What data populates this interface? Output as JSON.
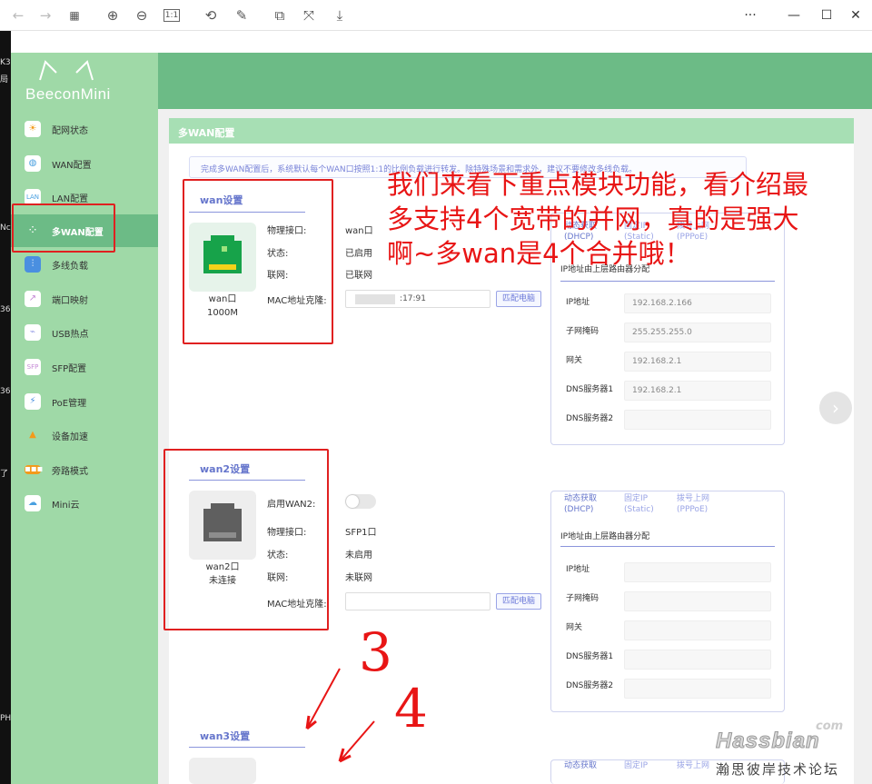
{
  "viewer": {
    "icons": [
      "back-arrow-icon",
      "forward-arrow-icon",
      "grid-icon",
      "zoom-in-icon",
      "zoom-out-icon",
      "actual-size-icon",
      "rotate-icon",
      "edit-icon",
      "crop-icon",
      "fit-icon",
      "download-icon"
    ],
    "actual_size_label": "1:1",
    "more_label": "···",
    "minimize_label": "—",
    "maximize_label": "☐",
    "close_label": "✕"
  },
  "desktop": {
    "fragments": [
      "K3",
      "局",
      "Nc",
      "36",
      "36",
      "了",
      "PH"
    ]
  },
  "app": {
    "logo": "BeeconMini",
    "nav": [
      {
        "label": "配网状态",
        "icon": "sun-icon"
      },
      {
        "label": "WAN配置",
        "icon": "globe-icon"
      },
      {
        "label": "LAN配置",
        "icon": "lan-icon"
      },
      {
        "label": "多WAN配置",
        "icon": "multi-wan-icon",
        "active": true
      },
      {
        "label": "多线负载",
        "icon": "sliders-icon"
      },
      {
        "label": "端口映射",
        "icon": "chart-icon"
      },
      {
        "label": "USB热点",
        "icon": "usb-icon"
      },
      {
        "label": "SFP配置",
        "icon": "sfp-icon"
      },
      {
        "label": "PoE管理",
        "icon": "plug-icon"
      },
      {
        "label": "设备加速",
        "icon": "rocket-icon"
      },
      {
        "label": "旁路模式",
        "icon": "bypass-icon"
      },
      {
        "label": "Mini云",
        "icon": "cloud-icon"
      }
    ],
    "section_title": "多WAN配置",
    "notice": "完成多WAN配置后，系统默认每个WAN口按照1:1的比例负载进行转发。除特殊场景和需求外，建议不要修改多线负载。",
    "wan1": {
      "title": "wan设置",
      "port_name": "wan口",
      "port_speed": "1000M",
      "labels": {
        "physical": "物理接口:",
        "status": "状态:",
        "net": "联网:",
        "mac": "MAC地址克隆:"
      },
      "values": {
        "physical": "wan口",
        "status": "已启用",
        "net": "已联网",
        "mac_tail": ":17:91"
      },
      "match_button": "匹配电脑",
      "tabs": [
        {
          "line1": "动态获取",
          "line2": "(DHCP)"
        },
        {
          "line1": "固定IP",
          "line2": "(Static)"
        },
        {
          "line1": "拨号上网",
          "line2": "(PPPoE)"
        }
      ],
      "sub_text": "IP地址由上层路由器分配",
      "rows": [
        {
          "label": "IP地址",
          "value": "192.168.2.166"
        },
        {
          "label": "子网掩码",
          "value": "255.255.255.0"
        },
        {
          "label": "网关",
          "value": "192.168.2.1"
        },
        {
          "label": "DNS服务器1",
          "value": "192.168.2.1"
        },
        {
          "label": "DNS服务器2",
          "value": ""
        }
      ]
    },
    "wan2": {
      "title": "wan2设置",
      "port_name": "wan2口",
      "port_status": "未连接",
      "labels": {
        "enable": "启用WAN2:",
        "physical": "物理接口:",
        "status": "状态:",
        "net": "联网:",
        "mac": "MAC地址克隆:"
      },
      "values": {
        "physical": "SFP1口",
        "status": "未启用",
        "net": "未联网"
      },
      "toggle_on": false,
      "match_button": "匹配电脑",
      "tabs": [
        {
          "line1": "动态获取",
          "line2": "(DHCP)"
        },
        {
          "line1": "固定IP",
          "line2": "(Static)"
        },
        {
          "line1": "拨号上网",
          "line2": "(PPPoE)"
        }
      ],
      "sub_text": "IP地址由上层路由器分配",
      "rows": [
        {
          "label": "IP地址",
          "value": ""
        },
        {
          "label": "子网掩码",
          "value": ""
        },
        {
          "label": "网关",
          "value": ""
        },
        {
          "label": "DNS服务器1",
          "value": ""
        },
        {
          "label": "DNS服务器2",
          "value": ""
        }
      ]
    },
    "wan3": {
      "title": "wan3设置",
      "tabs": [
        {
          "line1": "动态获取"
        },
        {
          "line1": "固定IP"
        },
        {
          "line1": "拨号上网"
        }
      ]
    }
  },
  "annotation": {
    "text": "我们来看下重点模块功能，看介绍最多支持4个宽带的并网，真的是强大啊~多wan是4个合并哦！",
    "num3": "3",
    "num4": "4",
    "color": "#e81515"
  },
  "watermark": {
    "com": "com",
    "main": "Hassbian",
    "sub": "瀚思彼岸技术论坛"
  }
}
